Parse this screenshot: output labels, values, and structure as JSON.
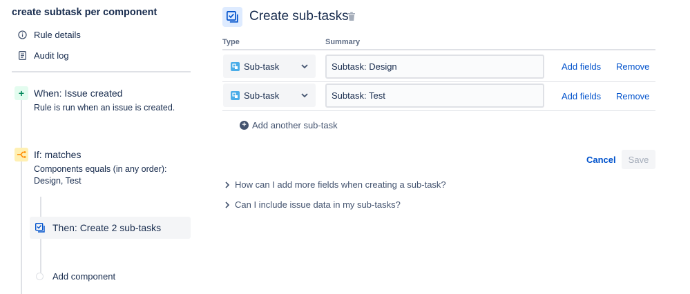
{
  "sidebar": {
    "rule_title": "create subtask per component",
    "links": [
      {
        "label": "Rule details",
        "icon": "info-icon"
      },
      {
        "label": "Audit log",
        "icon": "document-icon"
      }
    ],
    "trigger": {
      "title": "When: Issue created",
      "desc": "Rule is run when an issue is created."
    },
    "condition": {
      "title": "If: matches",
      "desc_line1": "Components equals (in any order):",
      "desc_line2": "Design, Test"
    },
    "action": {
      "label": "Then: Create 2 sub-tasks"
    },
    "add_component": "Add component"
  },
  "main": {
    "title": "Create sub-tasks",
    "col_type": "Type",
    "col_summary": "Summary",
    "rows": [
      {
        "type": "Sub-task",
        "summary": "Subtask: Design",
        "add_fields": "Add fields",
        "remove": "Remove"
      },
      {
        "type": "Sub-task",
        "summary": "Subtask: Test",
        "add_fields": "Add fields",
        "remove": "Remove"
      }
    ],
    "add_subtask": "Add another sub-task",
    "cancel": "Cancel",
    "save": "Save",
    "faq": [
      "How can I add more fields when creating a sub-task?",
      "Can I include issue data in my sub-tasks?"
    ]
  },
  "colors": {
    "link": "#0052cc",
    "trigger_bg": "#e3fcef",
    "trigger_fg": "#00875a",
    "condition_bg": "#fff0b3",
    "condition_fg": "#ff8b00",
    "action_bg": "#deebff",
    "subtask_icon": "#4bade8"
  }
}
